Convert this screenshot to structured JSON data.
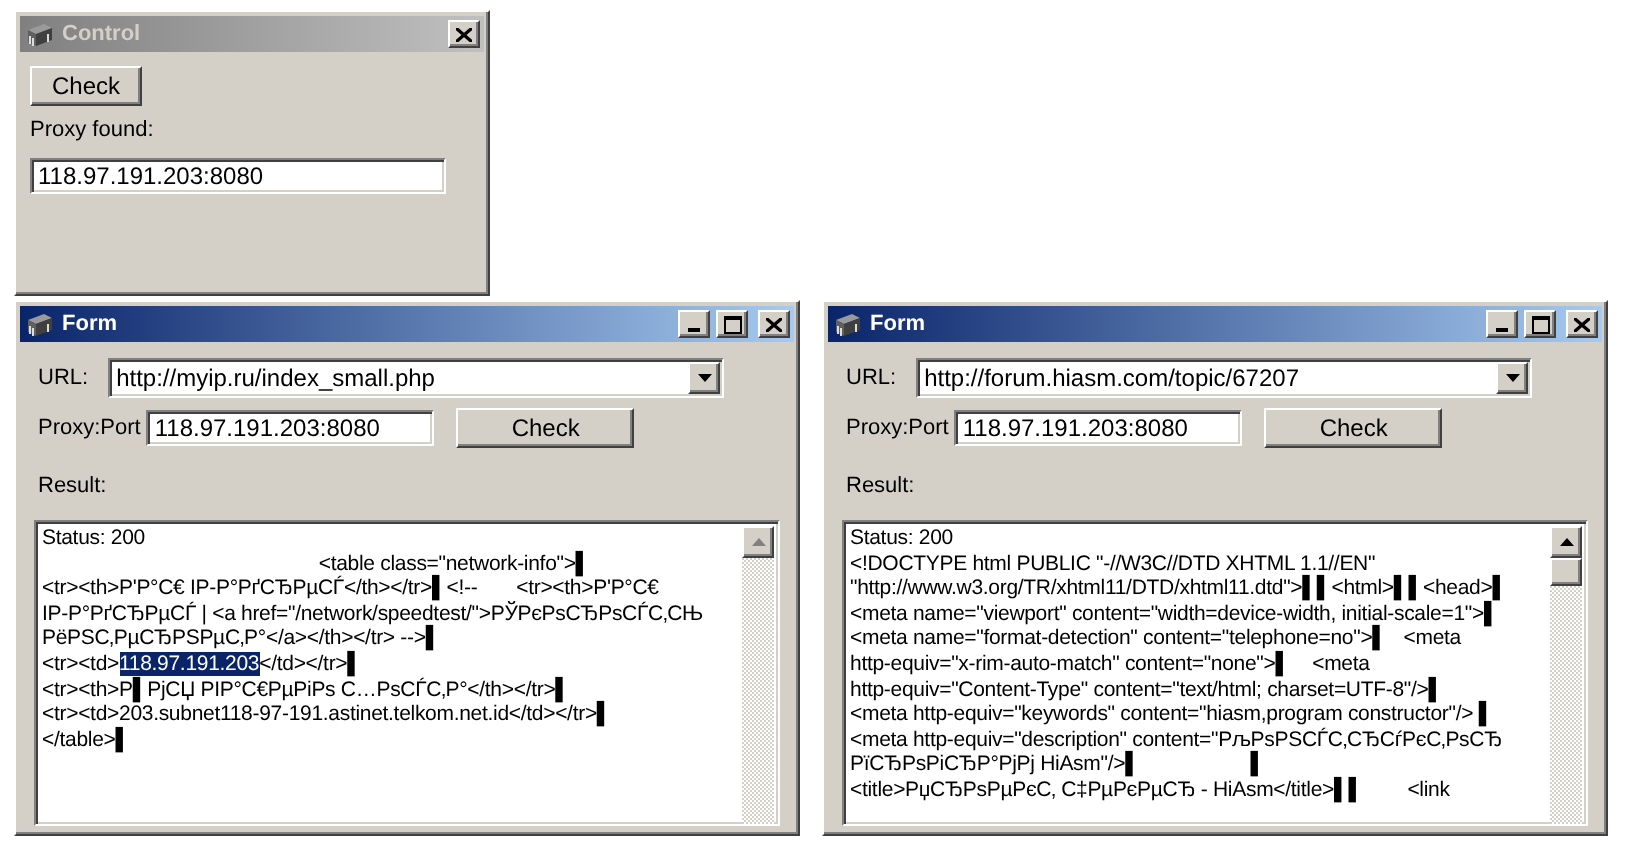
{
  "control_window": {
    "title": "Control",
    "active": false,
    "minimizable": false,
    "maximizable": false,
    "check_button": "Check",
    "proxy_label": "Proxy found:",
    "proxy_value": "118.97.191.203:8080"
  },
  "form_windows": [
    {
      "title": "Form",
      "active": true,
      "minimizable": true,
      "maximizable": true,
      "url_label": "URL:",
      "url_value": "http://myip.ru/index_small.php",
      "proxy_label": "Proxy:Port",
      "proxy_value": "118.97.191.203:8080",
      "check_button": "Check",
      "result_label": "Result:",
      "result_scrollable": false,
      "result_lines": [
        [
          {
            "text": "Status: 200",
            "selected": false
          }
        ],
        [
          {
            "text": "                                                  <table class=\"network-info\">▌",
            "selected": false
          }
        ],
        [
          {
            "text": "<tr><th>Р'Р°С€ IP-Р°РґСЂРµСЃ</th></tr>▌<!--       <tr><th>Р'Р°С€",
            "selected": false
          }
        ],
        [
          {
            "text": "IP-Р°РґСЂРµСЃ | <a href=\"/network/speedtest/\">РЎРєРѕСЂРѕСЃС‚СЊ",
            "selected": false
          }
        ],
        [
          {
            "text": "РёРЅС‚РµСЂРЅРµС‚Р°</a></th></tr> -->▌",
            "selected": false
          }
        ],
        [
          {
            "text": "<tr><td>",
            "selected": false
          },
          {
            "text": "118.97.191.203",
            "selected": true
          },
          {
            "text": "</td></tr>▌",
            "selected": false
          }
        ],
        [
          {
            "text": "<tr><th>Р▌РјСЏ РІР°С€РµРіРѕ С…РѕСЃС‚Р°</th></tr>▌",
            "selected": false
          }
        ],
        [
          {
            "text": "<tr><td>203.subnet118-97-191.astinet.telkom.net.id</td></tr>▌",
            "selected": false
          }
        ],
        [
          {
            "text": "</table>▌",
            "selected": false
          }
        ]
      ]
    },
    {
      "title": "Form",
      "active": true,
      "minimizable": true,
      "maximizable": true,
      "url_label": "URL:",
      "url_value": "http://forum.hiasm.com/topic/67207",
      "proxy_label": "Proxy:Port",
      "proxy_value": "118.97.191.203:8080",
      "check_button": "Check",
      "result_label": "Result:",
      "result_scrollable": true,
      "result_lines": [
        [
          {
            "text": "Status: 200",
            "selected": false
          }
        ],
        [
          {
            "text": "<!DOCTYPE html PUBLIC \"-//W3C//DTD XHTML 1.1//EN\"",
            "selected": false
          }
        ],
        [
          {
            "text": "\"http://www.w3.org/TR/xhtml11/DTD/xhtml11.dtd\">▌▌<html>▌▌<head>▌",
            "selected": false
          }
        ],
        [
          {
            "text": "<meta name=\"viewport\" content=\"width=device-width, initial-scale=1\">▌",
            "selected": false
          }
        ],
        [
          {
            "text": "<meta name=\"format-detection\" content=\"telephone=no\">▌   <meta",
            "selected": false
          }
        ],
        [
          {
            "text": "http-equiv=\"x-rim-auto-match\" content=\"none\">▌    <meta",
            "selected": false
          }
        ],
        [
          {
            "text": "http-equiv=\"Content-Type\" content=\"text/html; charset=UTF-8\"/>▌",
            "selected": false
          }
        ],
        [
          {
            "text": "<meta http-equiv=\"keywords\" content=\"hiasm,program constructor\"/> ▌",
            "selected": false
          }
        ],
        [
          {
            "text": "<meta http-equiv=\"description\" content=\"РљРѕРЅСЃС‚СЂСѓРєС‚РѕСЂ",
            "selected": false
          }
        ],
        [
          {
            "text": "РїСЂРѕРіСЂР°РјРј HiAsm\"/>▌                    ▌",
            "selected": false
          }
        ],
        [
          {
            "text": "<title>РџСЂРѕРµРєС‚ С‡РµРєРµСЂ - HiAsm</title>▌▌        <link",
            "selected": false
          }
        ]
      ]
    }
  ]
}
